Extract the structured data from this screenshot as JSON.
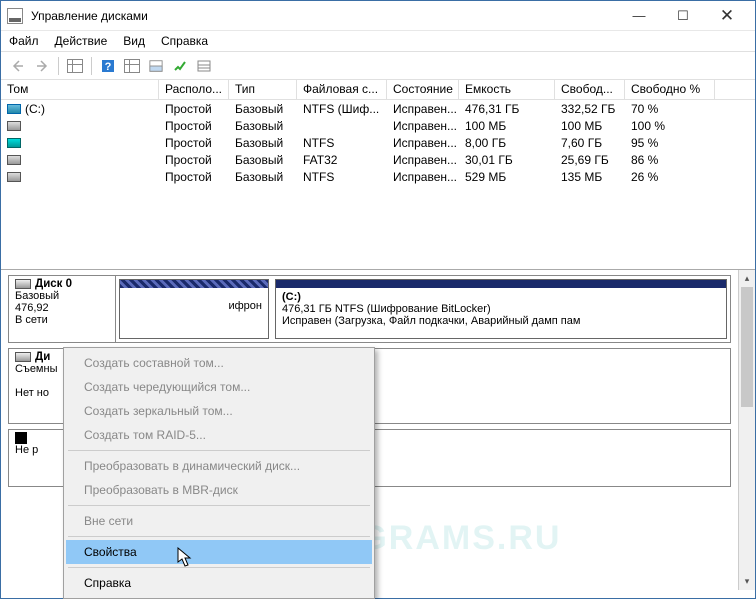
{
  "title": "Управление дисками",
  "menu": {
    "file": "Файл",
    "action": "Действие",
    "view": "Вид",
    "help": "Справка"
  },
  "columns": {
    "vol": "Том",
    "layout": "Располо...",
    "type": "Тип",
    "fs": "Файловая с...",
    "status": "Состояние",
    "cap": "Емкость",
    "free": "Свобод...",
    "pct": "Свободно %"
  },
  "volumes": [
    {
      "icon": "blue",
      "name": "(C:)",
      "layout": "Простой",
      "type": "Базовый",
      "fs": "NTFS (Шиф...",
      "status": "Исправен...",
      "cap": "476,31 ГБ",
      "free": "332,52 ГБ",
      "pct": "70 %"
    },
    {
      "icon": "gray",
      "name": "",
      "layout": "Простой",
      "type": "Базовый",
      "fs": "",
      "status": "Исправен...",
      "cap": "100 МБ",
      "free": "100 МБ",
      "pct": "100 %"
    },
    {
      "icon": "teal",
      "name": "",
      "layout": "Простой",
      "type": "Базовый",
      "fs": "NTFS",
      "status": "Исправен...",
      "cap": "8,00 ГБ",
      "free": "7,60 ГБ",
      "pct": "95 %"
    },
    {
      "icon": "gray",
      "name": "",
      "layout": "Простой",
      "type": "Базовый",
      "fs": "FAT32",
      "status": "Исправен...",
      "cap": "30,01 ГБ",
      "free": "25,69 ГБ",
      "pct": "86 %"
    },
    {
      "icon": "gray",
      "name": "",
      "layout": "Простой",
      "type": "Базовый",
      "fs": "NTFS",
      "status": "Исправен...",
      "cap": "529 МБ",
      "free": "135 МБ",
      "pct": "26 %"
    }
  ],
  "disk0": {
    "name": "Диск 0",
    "type": "Базовый",
    "size": "476,92",
    "status": "В сети",
    "part1_title": "",
    "part1_sub": "ифрон",
    "part2_title": "(C:)",
    "part2_line1": "476,31 ГБ NTFS (Шифрование BitLocker)",
    "part2_line2": "Исправен (Загрузка, Файл подкачки, Аварийный дамп пам"
  },
  "disk1": {
    "name": "Ди",
    "type": "Съемны",
    "status": "Нет но"
  },
  "disk2": {
    "name": "",
    "status": "Не р"
  },
  "context": {
    "spanned": "Создать составной том...",
    "striped": "Создать чередующийся том...",
    "mirrored": "Создать зеркальный том...",
    "raid5": "Создать том RAID-5...",
    "dynamic": "Преобразовать в динамический диск...",
    "mbr": "Преобразовать в MBR-диск",
    "offline": "Вне сети",
    "properties": "Свойства",
    "help": "Справка"
  },
  "watermark": "BOXPROGRAMS.RU"
}
